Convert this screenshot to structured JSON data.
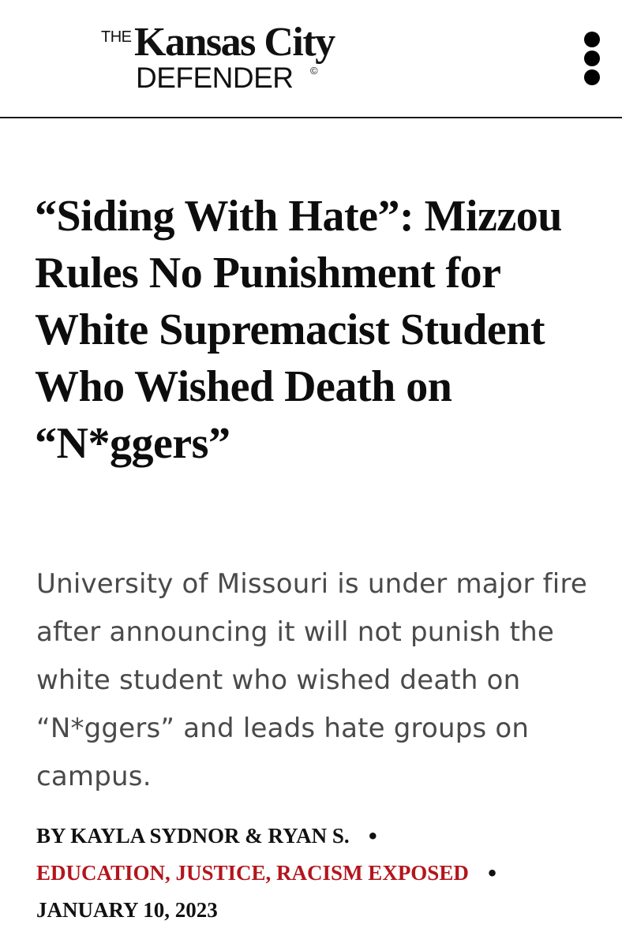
{
  "header": {
    "logo": {
      "the": "THE",
      "name": "Kansas City",
      "defender": "DEFENDER",
      "copyright": "©"
    },
    "menu_icon": "vertical-dots-icon"
  },
  "article": {
    "headline": "“Siding With Hate”: Mizzou Rules No Punishment for White Supremacist Student Who Wished Death on “N*ggers”",
    "dek": "University of Missouri is under major fire after announcing it will not punish the white student who wished death on “N*ggers” and leads hate groups on campus.",
    "byline": "BY KAYLA SYDNOR & RYAN S.",
    "categories": "EDUCATION, JUSTICE, RACISM EXPOSED",
    "separator": "•",
    "date": "JANUARY 10, 2023"
  },
  "colors": {
    "category_accent": "#b3151c",
    "text": "#111111",
    "dek_text": "#4a4a4a"
  }
}
